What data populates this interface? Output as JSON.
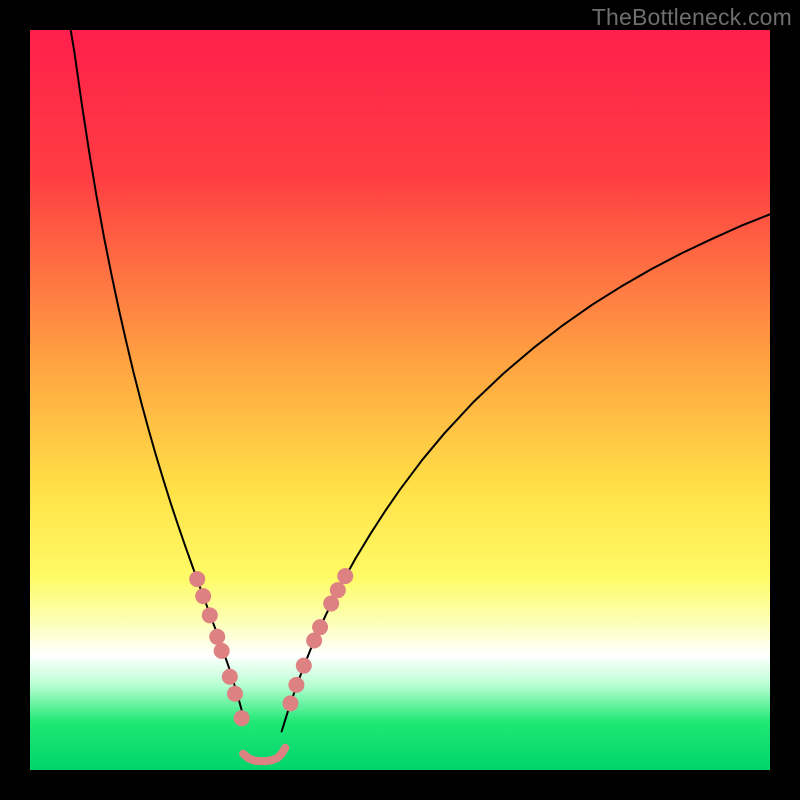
{
  "watermark": "TheBottleneck.com",
  "chart_data": {
    "type": "line",
    "title": "",
    "xlabel": "",
    "ylabel": "",
    "xlim": [
      0,
      100
    ],
    "ylim": [
      0,
      100
    ],
    "gradient_stops": [
      {
        "offset": 0.0,
        "color": "#ff1f4b"
      },
      {
        "offset": 0.2,
        "color": "#ff3e43"
      },
      {
        "offset": 0.45,
        "color": "#ffa341"
      },
      {
        "offset": 0.62,
        "color": "#ffe147"
      },
      {
        "offset": 0.74,
        "color": "#fffb66"
      },
      {
        "offset": 0.8,
        "color": "#fdffb8"
      },
      {
        "offset": 0.845,
        "color": "#ffffff"
      },
      {
        "offset": 0.885,
        "color": "#b9ffd4"
      },
      {
        "offset": 0.935,
        "color": "#20e874"
      },
      {
        "offset": 1.0,
        "color": "#00d56b"
      }
    ],
    "series": [
      {
        "name": "left-curve",
        "color": "#000000",
        "stroke_width": 2,
        "x": [
          5.5,
          6,
          7,
          8,
          9,
          10,
          11,
          12,
          13,
          14,
          15,
          16,
          17,
          18,
          19,
          20,
          21,
          22,
          23,
          24,
          25,
          26,
          27,
          28,
          29
        ],
        "y": [
          100,
          97,
          90,
          83.5,
          77.5,
          72,
          67,
          62.3,
          57.9,
          53.7,
          49.8,
          46.1,
          42.6,
          39.3,
          36.1,
          33.1,
          30.2,
          27.4,
          24.6,
          21.9,
          19.2,
          16.4,
          13.5,
          10.3,
          6.6
        ]
      },
      {
        "name": "right-curve",
        "color": "#000000",
        "stroke_width": 2,
        "x": [
          34,
          35,
          36,
          37,
          38,
          39,
          40,
          42,
          44,
          46,
          48,
          50,
          53,
          56,
          60,
          64,
          68,
          72,
          76,
          80,
          84,
          88,
          92,
          96,
          100
        ],
        "y": [
          5.2,
          8.4,
          11.3,
          14.0,
          16.5,
          18.8,
          21.0,
          25.0,
          28.6,
          31.9,
          35.0,
          37.9,
          41.9,
          45.5,
          49.8,
          53.6,
          57.0,
          60.1,
          62.9,
          65.4,
          67.7,
          69.8,
          71.7,
          73.5,
          75.1
        ]
      },
      {
        "name": "valley-floor",
        "color": "#dd8182",
        "stroke_width": 8,
        "x": [
          28.8,
          29.5,
          30.2,
          31.0,
          31.8,
          32.6,
          33.4,
          34.0,
          34.5
        ],
        "y": [
          2.2,
          1.6,
          1.3,
          1.2,
          1.2,
          1.3,
          1.6,
          2.2,
          3.0
        ]
      }
    ],
    "scatter": [
      {
        "name": "left-dots",
        "color": "#dd8182",
        "r": 8,
        "points": [
          [
            22.6,
            25.8
          ],
          [
            23.4,
            23.5
          ],
          [
            24.3,
            20.9
          ],
          [
            25.3,
            18.0
          ],
          [
            25.9,
            16.1
          ],
          [
            27.0,
            12.6
          ],
          [
            27.7,
            10.3
          ],
          [
            28.6,
            7.0
          ]
        ]
      },
      {
        "name": "right-dots",
        "color": "#dd8182",
        "r": 8,
        "points": [
          [
            35.2,
            9.0
          ],
          [
            36.0,
            11.5
          ],
          [
            37.0,
            14.1
          ],
          [
            38.4,
            17.5
          ],
          [
            39.2,
            19.3
          ],
          [
            40.7,
            22.5
          ],
          [
            41.6,
            24.3
          ],
          [
            42.6,
            26.2
          ]
        ]
      }
    ]
  }
}
